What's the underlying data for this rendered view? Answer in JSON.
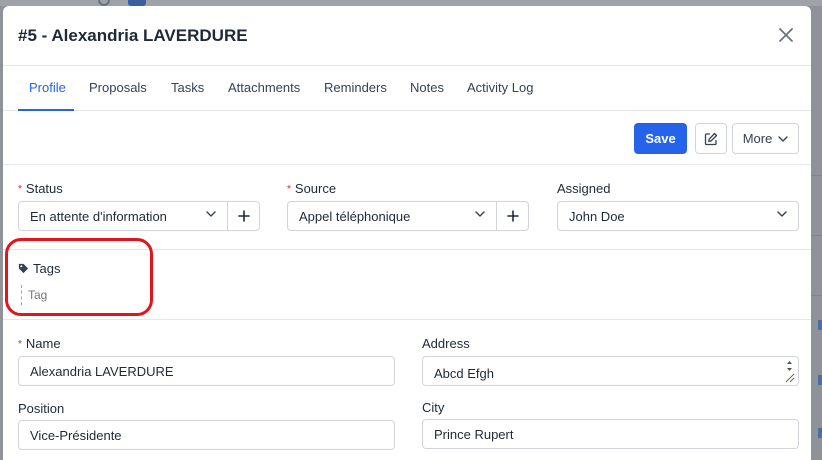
{
  "modal": {
    "title": "#5 - Alexandria LAVERDURE"
  },
  "tabs": [
    {
      "label": "Profile",
      "active": true
    },
    {
      "label": "Proposals",
      "active": false
    },
    {
      "label": "Tasks",
      "active": false
    },
    {
      "label": "Attachments",
      "active": false
    },
    {
      "label": "Reminders",
      "active": false
    },
    {
      "label": "Notes",
      "active": false
    },
    {
      "label": "Activity Log",
      "active": false
    }
  ],
  "toolbar": {
    "save_label": "Save",
    "more_label": "More"
  },
  "fields": {
    "status": {
      "label": "Status",
      "required_mark": "*",
      "value": "En attente d'information"
    },
    "source": {
      "label": "Source",
      "required_mark": "*",
      "value": "Appel téléphonique"
    },
    "assigned": {
      "label": "Assigned",
      "value": "John Doe"
    },
    "tags": {
      "label": "Tags",
      "placeholder": "Tag"
    },
    "name": {
      "label": "Name",
      "required_mark": "*",
      "value": "Alexandria LAVERDURE"
    },
    "address": {
      "label": "Address",
      "value": "Abcd Efgh"
    },
    "position": {
      "label": "Position",
      "value": "Vice-Présidente"
    },
    "city": {
      "label": "City",
      "value": "Prince Rupert"
    }
  },
  "colors": {
    "accent": "#2563eb",
    "required": "#dc2626",
    "highlight": "#e0161e"
  }
}
